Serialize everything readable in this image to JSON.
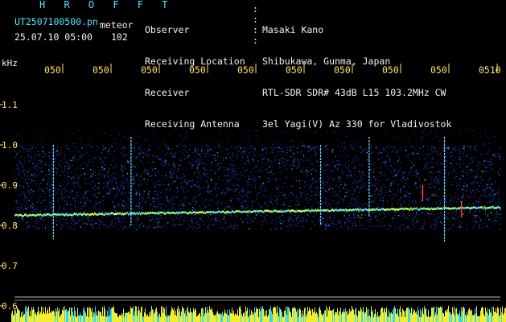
{
  "header": {
    "app_name": "H R O F F T",
    "file_name": "UT2507100500.pn",
    "plot_label": "meteor",
    "datetime": "25.07.10 05:00",
    "count": "102",
    "fields": [
      {
        "label": "Observer",
        "value": "Masaki Kano"
      },
      {
        "label": "Receiving Location",
        "value": "Shibukawa, Gunma, Japan"
      },
      {
        "label": "Receiver",
        "value": "RTL-SDR SDR# 43dB L15 103.2MHz CW"
      },
      {
        "label": "Receiving Antenna",
        "value": "3el Yagi(V) Az 330 for Vladivostok"
      }
    ]
  },
  "colors": {
    "background": "#000000",
    "header_text_cyan": "#4fe6ff",
    "label_text_white": "#f2f2f2",
    "axis_tick_yellow": "#ffe566",
    "spectrum_blue": "#1a3dff",
    "signal_yellow": "#e8ff40",
    "meteor_red": "#ff4040"
  },
  "chart_data": {
    "type": "heatmap",
    "ylabel": "kHz",
    "ylim": [
      0.6,
      1.2
    ],
    "y_ticks": [
      "1.1",
      "1.0",
      "0.9",
      "0.8",
      "0.7",
      "0.6"
    ],
    "x_ticks": [
      "050",
      "050",
      "050",
      "050",
      "050",
      "050",
      "050",
      "050",
      "050",
      "0510"
    ],
    "carrier_frequency_khz": {
      "start": 0.825,
      "end": 0.845
    },
    "noise_band_khz": [
      0.79,
      1.0
    ],
    "meteor_echoes": [
      {
        "x": 0.08,
        "low": 0.765,
        "high": 1.0
      },
      {
        "x": 0.24,
        "low": 0.8,
        "high": 1.02
      },
      {
        "x": 0.63,
        "low": 0.8,
        "high": 1.0
      },
      {
        "x": 0.73,
        "low": 0.82,
        "high": 1.02
      },
      {
        "x": 0.84,
        "low": 0.86,
        "high": 0.9
      },
      {
        "x": 0.885,
        "low": 0.76,
        "high": 1.02
      },
      {
        "x": 0.92,
        "low": 0.82,
        "high": 0.86
      }
    ],
    "grid": false,
    "legend": "none"
  }
}
